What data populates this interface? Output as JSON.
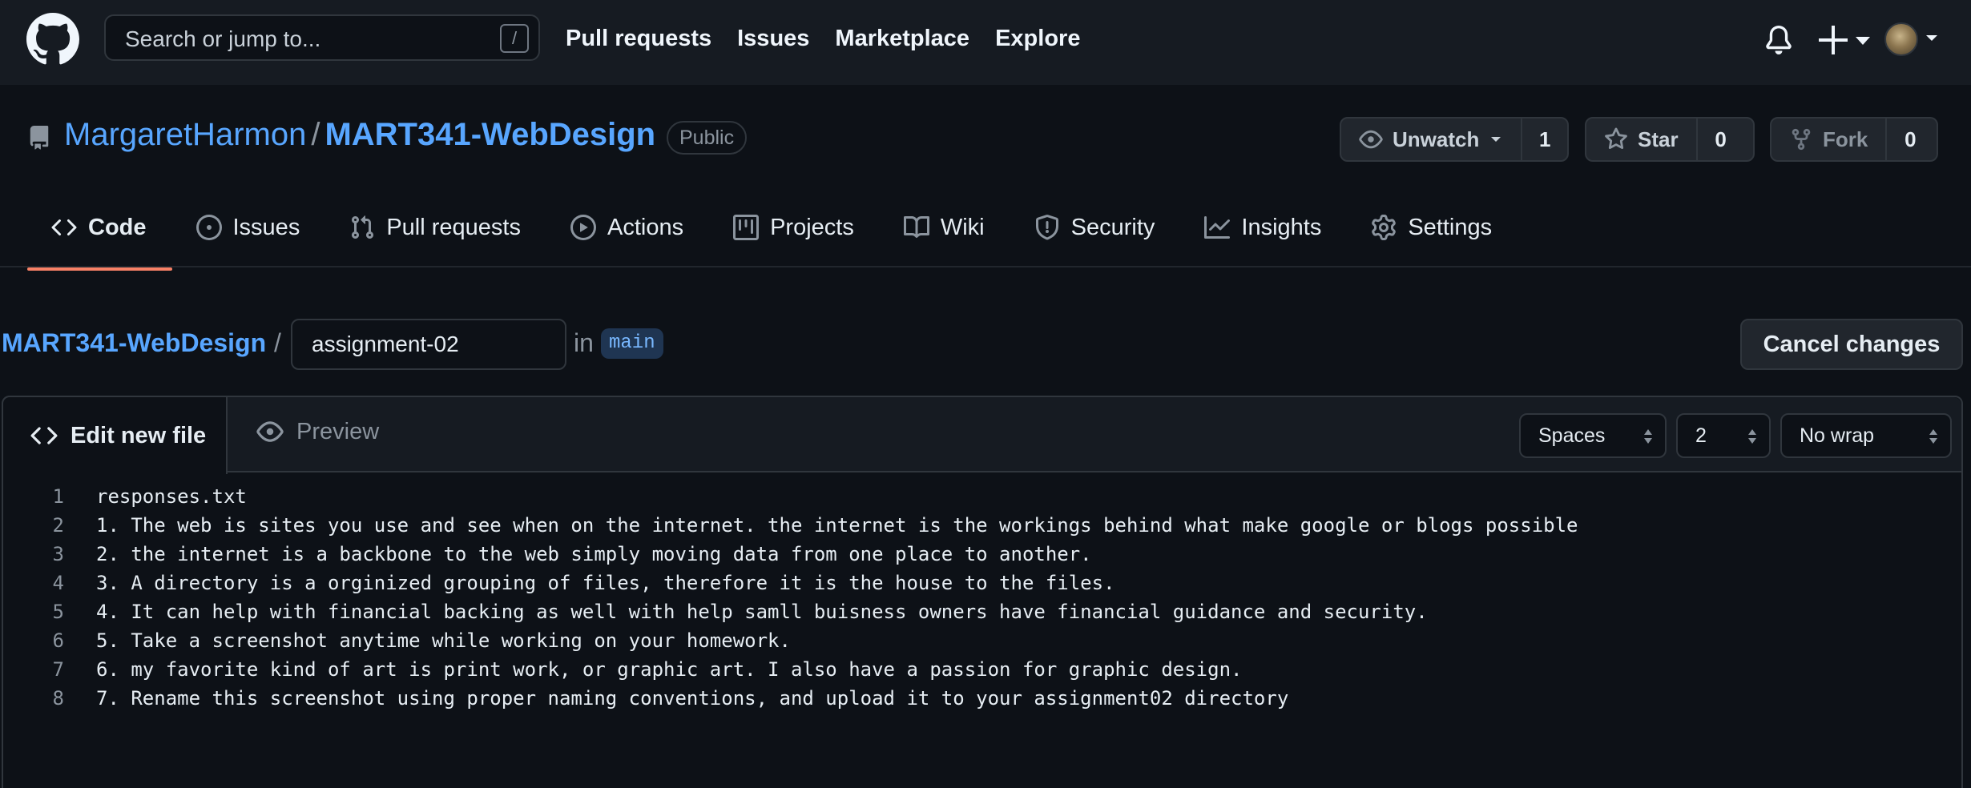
{
  "header": {
    "search_placeholder": "Search or jump to...",
    "search_shortcut": "/",
    "nav": [
      "Pull requests",
      "Issues",
      "Marketplace",
      "Explore"
    ]
  },
  "repo": {
    "owner": "MargaretHarmon",
    "separator": "/",
    "name": "MART341-WebDesign",
    "visibility": "Public",
    "watch": {
      "label": "Unwatch",
      "count": "1"
    },
    "star": {
      "label": "Star",
      "count": "0"
    },
    "fork": {
      "label": "Fork",
      "count": "0"
    }
  },
  "tabs": [
    {
      "label": "Code",
      "icon": "code-icon",
      "active": true
    },
    {
      "label": "Issues",
      "icon": "issue-icon"
    },
    {
      "label": "Pull requests",
      "icon": "pull-request-icon"
    },
    {
      "label": "Actions",
      "icon": "play-icon"
    },
    {
      "label": "Projects",
      "icon": "project-icon"
    },
    {
      "label": "Wiki",
      "icon": "book-icon"
    },
    {
      "label": "Security",
      "icon": "shield-icon"
    },
    {
      "label": "Insights",
      "icon": "graph-icon"
    },
    {
      "label": "Settings",
      "icon": "gear-icon"
    }
  ],
  "edit": {
    "repo_link": "MART341-WebDesign",
    "separator": "/",
    "filename": "assignment-02",
    "in_label": "in",
    "branch": "main",
    "cancel_label": "Cancel changes"
  },
  "editor": {
    "edit_tab": "Edit new file",
    "preview_tab": "Preview",
    "indent_mode": "Spaces",
    "indent_size": "2",
    "wrap_mode": "No wrap",
    "lines": [
      {
        "n": "1",
        "text": "responses.txt"
      },
      {
        "n": "2",
        "text": "1. The web is sites you use and see when on the internet. the internet is the workings behind what make google or blogs possible"
      },
      {
        "n": "3",
        "text": "2. the internet is a backbone to the web simply moving data from one place to another."
      },
      {
        "n": "4",
        "text": "3. A directory is a orginized grouping of files, therefore it is the house to the files."
      },
      {
        "n": "5",
        "text": "4. It can help with financial backing as well with help samll buisness owners have financial guidance and security."
      },
      {
        "n": "6",
        "text": "5. Take a screenshot anytime while working on your homework."
      },
      {
        "n": "7",
        "text": "6. my favorite kind of art is print work, or graphic art. I also have a passion for graphic design."
      },
      {
        "n": "8",
        "text": "7. Rename this screenshot using proper naming conventions, and upload it to your assignment02 directory"
      }
    ]
  },
  "colors": {
    "background": "#0d1117",
    "header_bg": "#161b22",
    "link": "#58a6ff",
    "active_tab_underline": "#f78166",
    "border": "#30363d"
  }
}
